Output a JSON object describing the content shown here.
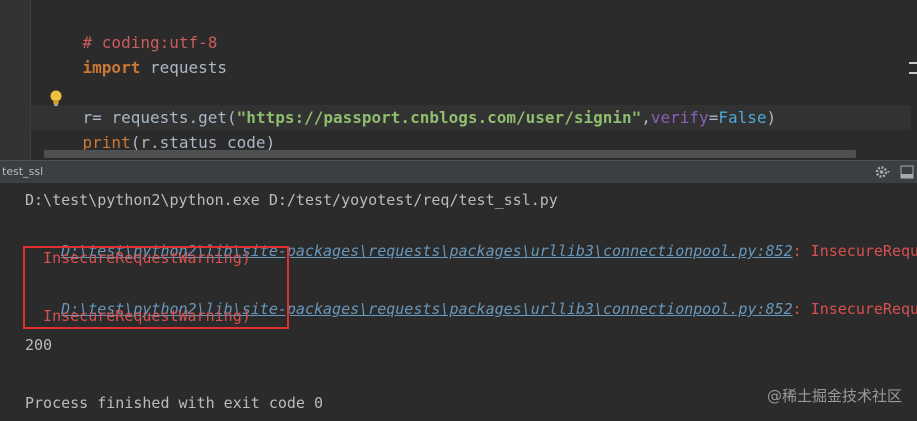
{
  "editor": {
    "line1_comment": "# coding:utf-8",
    "line2_keyword": "import",
    "line2_module": " requests",
    "line4_var_start": "r",
    "line4_assign": "= requests.get(",
    "line4_url": "\"https://passport.cnblogs.com/user/signin\"",
    "line4_comma": ",",
    "line4_param": "verify",
    "line4_eq": "=",
    "line4_false": "False",
    "line4_close": ")",
    "line5_print": "print",
    "line5_open": "(r.status_code",
    "line5_close": ")"
  },
  "run_panel": {
    "title": "test_ssl"
  },
  "console": {
    "command": "D:\\test\\python2\\python.exe D:/test/yoyotest/req/test_ssl.py",
    "warning1_path": "D:\\test\\python2\\lib\\site-packages\\requests\\packages\\urllib3\\connectionpool.py:852",
    "warning1_text": ": InsecureRequestWa",
    "warning1_cont": "  InsecureRequestWarning)",
    "warning2_path": "D:\\test\\python2\\lib\\site-packages\\requests\\packages\\urllib3\\connectionpool.py:852",
    "warning2_text": ": InsecureRequestWa",
    "warning2_cont": "  InsecureRequestWarning)",
    "output": "200",
    "exit_message": "Process finished with exit code 0"
  },
  "watermark": "@稀土掘金技术社区",
  "icons": {
    "bulb": "lightbulb-icon",
    "gear": "gear-icon",
    "hide": "hide-panel-icon"
  },
  "colors": {
    "background": "#2b2b2b",
    "comment": "#cc5c5c",
    "keyword": "#cc7832",
    "string": "#8fbd6e",
    "link": "#6897bb",
    "error": "#d95050",
    "highlight_box": "#e03030"
  }
}
